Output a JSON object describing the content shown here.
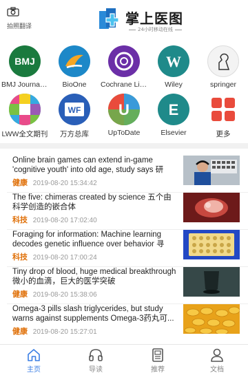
{
  "header": {
    "camera_label": "拍照翻译",
    "app_title": "掌上医图",
    "app_subtitle": "24小时移动在线"
  },
  "databases": [
    {
      "label": "BMJ Journals...",
      "icon": "bmj-icon",
      "color": "#1a7a3e",
      "glyph": "BMJ"
    },
    {
      "label": "BioOne",
      "icon": "bioone-icon",
      "color": "#1d88c8",
      "glyph": ""
    },
    {
      "label": "Cochrane Libr...",
      "icon": "cochrane-icon",
      "color": "#6b2fa7",
      "glyph": ""
    },
    {
      "label": "Wiley",
      "icon": "wiley-icon",
      "color": "#1f8a8a",
      "glyph": "W"
    },
    {
      "label": "springer",
      "icon": "springer-icon",
      "color": "#f3f3f3",
      "glyph": ""
    },
    {
      "label": "LWW全文期刊",
      "icon": "lww-icon",
      "color": "#2da86a",
      "glyph": ""
    },
    {
      "label": "万方总库",
      "icon": "wanfang-icon",
      "color": "#2a5fb8",
      "glyph": "WF"
    },
    {
      "label": "UpToDate",
      "icon": "uptodate-icon",
      "color": "#6ab04c",
      "glyph": "U"
    },
    {
      "label": "Elsevier",
      "icon": "elsevier-icon",
      "color": "#1f8a8a",
      "glyph": "E"
    },
    {
      "label": "更多",
      "icon": "more-icon",
      "color": "#f3f3f3",
      "glyph": ""
    }
  ],
  "news": [
    {
      "title": "Online brain games can extend in-game 'cognitive youth' into old age, study says 研究...",
      "category": "健康",
      "date": "2019-08-20 15:34:42",
      "thumb": "man-with-headphones"
    },
    {
      "title": "The five: chimeras created by science 五个由科学创造的嵌合体",
      "category": "科技",
      "date": "2019-08-20 17:02:40",
      "thumb": "embryo"
    },
    {
      "title": "Foraging for information: Machine learning decodes genetic influence over behavior 寻觅...",
      "category": "科技",
      "date": "2019-08-20 17:00:24",
      "thumb": "lab-plate"
    },
    {
      "title": "Tiny drop of blood, huge medical breakthrough 微小的血滴，巨大的医学突破",
      "category": "健康",
      "date": "2019-08-20 15:38:06",
      "thumb": "blood-drop"
    },
    {
      "title": "Omega-3 pills slash triglycerides, but study warns against supplements Omega-3药丸可...",
      "category": "健康",
      "date": "2019-08-20 15:27:01",
      "thumb": "omega3-capsules"
    }
  ],
  "bottom_nav": [
    {
      "label": "主页",
      "icon": "home-icon",
      "active": true
    },
    {
      "label": "导读",
      "icon": "headphones-icon",
      "active": false
    },
    {
      "label": "推荐",
      "icon": "document-icon",
      "active": false
    },
    {
      "label": "文档",
      "icon": "user-icon",
      "active": false
    }
  ],
  "colors": {
    "accent": "#3a7ee4",
    "category": "#e0710a",
    "date": "#999999"
  }
}
